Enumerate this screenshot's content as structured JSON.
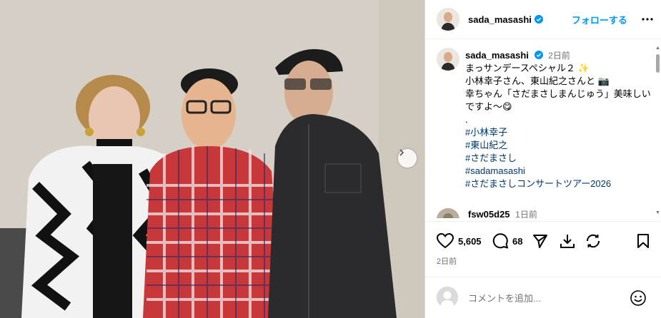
{
  "post": {
    "username": "sada_masashi",
    "follow_label": "フォローする",
    "caption_time": "2日前",
    "caption_lines": [
      "まっサンデースペシャル２ ✨",
      "小林幸子さん、東山紀之さんと 📷",
      "幸ちゃん「さだまさしまんじゅう」美味しいですよ〜😋",
      "."
    ],
    "hashtags": [
      "#小林幸子",
      "#東山紀之",
      "#さだまさし",
      "#sadamasashi",
      "#さだまさしコンサートツアー2026"
    ],
    "comment": {
      "username": "fsw05d25",
      "time": "1日前"
    },
    "likes": "5,605",
    "comments_count": "68",
    "date": "2日前",
    "comment_placeholder": "コメントを追加..."
  },
  "colors": {
    "link": "#0095f6",
    "hashtag": "#00376b",
    "muted": "#737373",
    "verified": "#0095f6"
  },
  "icons": [
    "verified-badge-icon",
    "more-icon",
    "heart-icon",
    "comment-icon",
    "share-icon",
    "download-icon",
    "repost-icon",
    "bookmark-icon",
    "emoji-icon",
    "chevron-right-icon"
  ]
}
